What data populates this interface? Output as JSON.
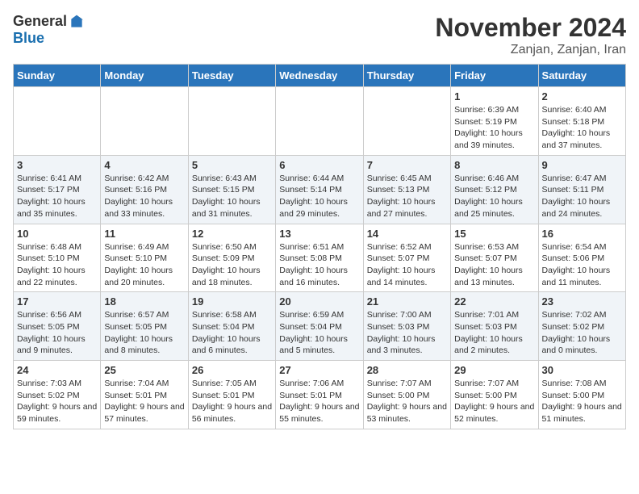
{
  "logo": {
    "general": "General",
    "blue": "Blue"
  },
  "title": "November 2024",
  "location": "Zanjan, Zanjan, Iran",
  "weekdays": [
    "Sunday",
    "Monday",
    "Tuesday",
    "Wednesday",
    "Thursday",
    "Friday",
    "Saturday"
  ],
  "weeks": [
    [
      {
        "day": "",
        "info": ""
      },
      {
        "day": "",
        "info": ""
      },
      {
        "day": "",
        "info": ""
      },
      {
        "day": "",
        "info": ""
      },
      {
        "day": "",
        "info": ""
      },
      {
        "day": "1",
        "info": "Sunrise: 6:39 AM\nSunset: 5:19 PM\nDaylight: 10 hours and 39 minutes."
      },
      {
        "day": "2",
        "info": "Sunrise: 6:40 AM\nSunset: 5:18 PM\nDaylight: 10 hours and 37 minutes."
      }
    ],
    [
      {
        "day": "3",
        "info": "Sunrise: 6:41 AM\nSunset: 5:17 PM\nDaylight: 10 hours and 35 minutes."
      },
      {
        "day": "4",
        "info": "Sunrise: 6:42 AM\nSunset: 5:16 PM\nDaylight: 10 hours and 33 minutes."
      },
      {
        "day": "5",
        "info": "Sunrise: 6:43 AM\nSunset: 5:15 PM\nDaylight: 10 hours and 31 minutes."
      },
      {
        "day": "6",
        "info": "Sunrise: 6:44 AM\nSunset: 5:14 PM\nDaylight: 10 hours and 29 minutes."
      },
      {
        "day": "7",
        "info": "Sunrise: 6:45 AM\nSunset: 5:13 PM\nDaylight: 10 hours and 27 minutes."
      },
      {
        "day": "8",
        "info": "Sunrise: 6:46 AM\nSunset: 5:12 PM\nDaylight: 10 hours and 25 minutes."
      },
      {
        "day": "9",
        "info": "Sunrise: 6:47 AM\nSunset: 5:11 PM\nDaylight: 10 hours and 24 minutes."
      }
    ],
    [
      {
        "day": "10",
        "info": "Sunrise: 6:48 AM\nSunset: 5:10 PM\nDaylight: 10 hours and 22 minutes."
      },
      {
        "day": "11",
        "info": "Sunrise: 6:49 AM\nSunset: 5:10 PM\nDaylight: 10 hours and 20 minutes."
      },
      {
        "day": "12",
        "info": "Sunrise: 6:50 AM\nSunset: 5:09 PM\nDaylight: 10 hours and 18 minutes."
      },
      {
        "day": "13",
        "info": "Sunrise: 6:51 AM\nSunset: 5:08 PM\nDaylight: 10 hours and 16 minutes."
      },
      {
        "day": "14",
        "info": "Sunrise: 6:52 AM\nSunset: 5:07 PM\nDaylight: 10 hours and 14 minutes."
      },
      {
        "day": "15",
        "info": "Sunrise: 6:53 AM\nSunset: 5:07 PM\nDaylight: 10 hours and 13 minutes."
      },
      {
        "day": "16",
        "info": "Sunrise: 6:54 AM\nSunset: 5:06 PM\nDaylight: 10 hours and 11 minutes."
      }
    ],
    [
      {
        "day": "17",
        "info": "Sunrise: 6:56 AM\nSunset: 5:05 PM\nDaylight: 10 hours and 9 minutes."
      },
      {
        "day": "18",
        "info": "Sunrise: 6:57 AM\nSunset: 5:05 PM\nDaylight: 10 hours and 8 minutes."
      },
      {
        "day": "19",
        "info": "Sunrise: 6:58 AM\nSunset: 5:04 PM\nDaylight: 10 hours and 6 minutes."
      },
      {
        "day": "20",
        "info": "Sunrise: 6:59 AM\nSunset: 5:04 PM\nDaylight: 10 hours and 5 minutes."
      },
      {
        "day": "21",
        "info": "Sunrise: 7:00 AM\nSunset: 5:03 PM\nDaylight: 10 hours and 3 minutes."
      },
      {
        "day": "22",
        "info": "Sunrise: 7:01 AM\nSunset: 5:03 PM\nDaylight: 10 hours and 2 minutes."
      },
      {
        "day": "23",
        "info": "Sunrise: 7:02 AM\nSunset: 5:02 PM\nDaylight: 10 hours and 0 minutes."
      }
    ],
    [
      {
        "day": "24",
        "info": "Sunrise: 7:03 AM\nSunset: 5:02 PM\nDaylight: 9 hours and 59 minutes."
      },
      {
        "day": "25",
        "info": "Sunrise: 7:04 AM\nSunset: 5:01 PM\nDaylight: 9 hours and 57 minutes."
      },
      {
        "day": "26",
        "info": "Sunrise: 7:05 AM\nSunset: 5:01 PM\nDaylight: 9 hours and 56 minutes."
      },
      {
        "day": "27",
        "info": "Sunrise: 7:06 AM\nSunset: 5:01 PM\nDaylight: 9 hours and 55 minutes."
      },
      {
        "day": "28",
        "info": "Sunrise: 7:07 AM\nSunset: 5:00 PM\nDaylight: 9 hours and 53 minutes."
      },
      {
        "day": "29",
        "info": "Sunrise: 7:07 AM\nSunset: 5:00 PM\nDaylight: 9 hours and 52 minutes."
      },
      {
        "day": "30",
        "info": "Sunrise: 7:08 AM\nSunset: 5:00 PM\nDaylight: 9 hours and 51 minutes."
      }
    ]
  ]
}
